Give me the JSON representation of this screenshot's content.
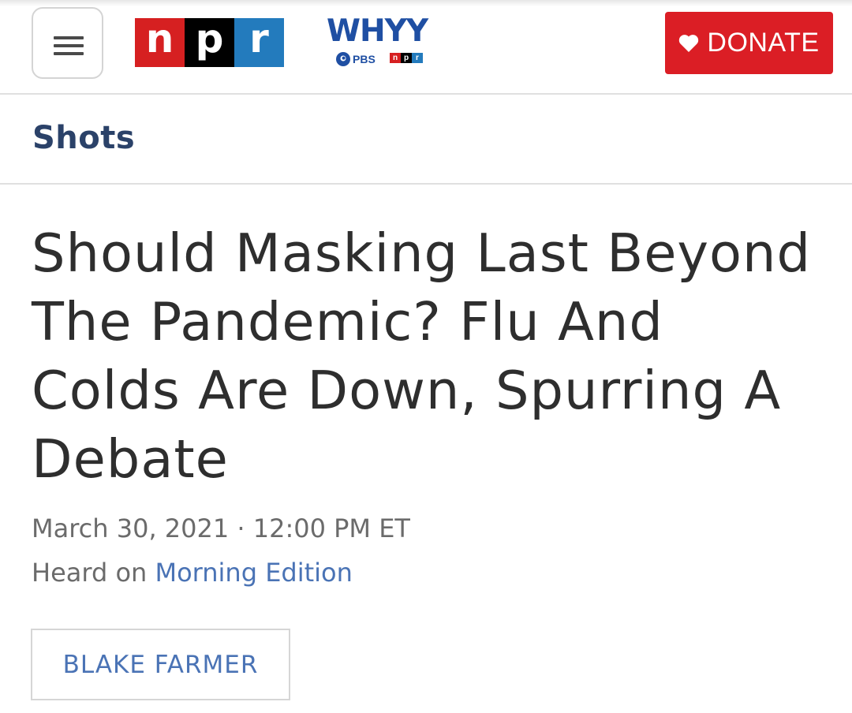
{
  "header": {
    "brand_letters": [
      "n",
      "p",
      "r"
    ],
    "station": {
      "name": "WHYY",
      "sub_pbs": "PBS",
      "sub_npr": [
        "n",
        "p",
        "r"
      ]
    },
    "donate_label": "DONATE"
  },
  "section": {
    "title": "Shots"
  },
  "article": {
    "headline": "Should Masking Last Beyond The Pandemic? Flu And Colds Are Down, Spurring A Debate",
    "dateline": "March 30, 2021 · 12:00 PM ET",
    "heard_prefix": "Heard on ",
    "heard_show": "Morning Edition",
    "author": "BLAKE FARMER"
  },
  "colors": {
    "npr_red": "#d62021",
    "npr_black": "#000000",
    "npr_blue": "#237bbd",
    "donate_red": "#db1e25",
    "section_navy": "#2b4269",
    "link_blue": "#4a73b5"
  },
  "icons": {
    "menu": "hamburger-menu-icon",
    "donate": "heart-icon"
  }
}
